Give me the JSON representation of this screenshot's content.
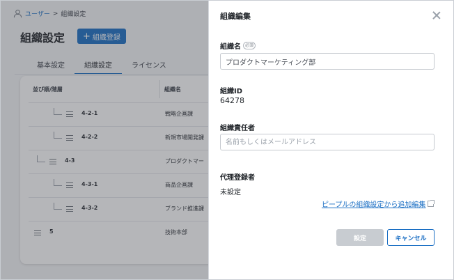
{
  "breadcrumb": {
    "parent": "ユーザー",
    "separator": ">",
    "current": "組織設定"
  },
  "page": {
    "title": "組織設定",
    "add_button": "組織登録"
  },
  "tabs": [
    {
      "label": "基本設定"
    },
    {
      "label": "組織設定",
      "active": true
    },
    {
      "label": "ライセンス"
    }
  ],
  "table": {
    "headers": {
      "sort": "並び順/階層",
      "name": "組織名"
    },
    "rows": [
      {
        "code": "4-2-1",
        "name": "戦略企画課",
        "level": 3
      },
      {
        "code": "4-2-2",
        "name": "新規市場開発課",
        "level": 3
      },
      {
        "code": "4-3",
        "name": "プロダクトマー",
        "level": 2
      },
      {
        "code": "4-3-1",
        "name": "商品企画課",
        "level": 3
      },
      {
        "code": "4-3-2",
        "name": "ブランド推進課",
        "level": 3
      },
      {
        "code": "5",
        "name": "技術本部",
        "level": 1
      }
    ]
  },
  "drawer": {
    "title": "組織編集",
    "org_name_label": "組織名",
    "required_badge": "必須",
    "org_name_value": "プロダクトマーケティング部",
    "org_id_label": "組織ID",
    "org_id_value": "64278",
    "manager_label": "組織責任者",
    "manager_placeholder": "名前もしくはメールアドレス",
    "proxy_label": "代理登録者",
    "proxy_value": "未設定",
    "external_link": "ピープルの組織設定から追加編集",
    "save_button": "設定",
    "cancel_button": "キャンセル"
  },
  "colors": {
    "accent": "#1b6fc4",
    "disabled": "#c8ccd1",
    "overlay": "rgba(60,64,72,0.38)"
  }
}
